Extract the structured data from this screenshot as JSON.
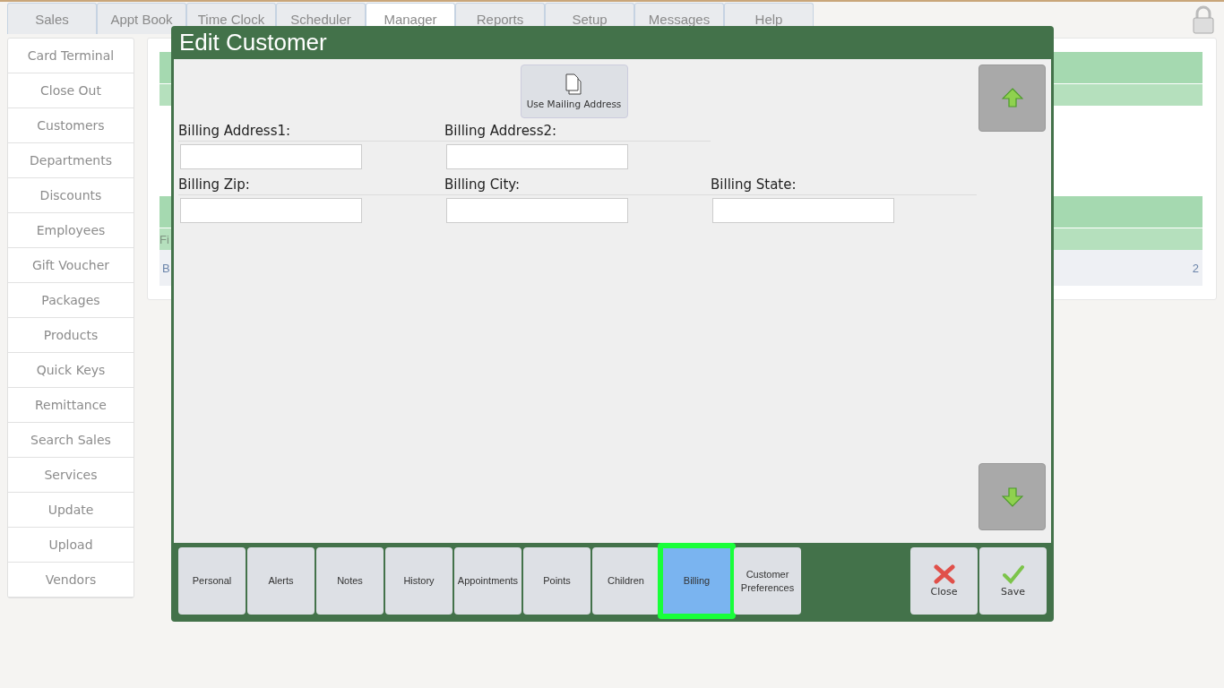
{
  "top_tabs": [
    {
      "label": "Sales",
      "selected": false
    },
    {
      "label": "Appt Book",
      "selected": false
    },
    {
      "label": "Time Clock",
      "selected": false
    },
    {
      "label": "Scheduler",
      "selected": false
    },
    {
      "label": "Manager",
      "selected": true
    },
    {
      "label": "Reports",
      "selected": false
    },
    {
      "label": "Setup",
      "selected": false
    },
    {
      "label": "Messages",
      "selected": false
    },
    {
      "label": "Help",
      "selected": false
    }
  ],
  "sidebar": {
    "items": [
      "Card Terminal",
      "Close Out",
      "Customers",
      "Departments",
      "Discounts",
      "Employees",
      "Gift Voucher",
      "Packages",
      "Products",
      "Quick Keys",
      "Remittance",
      "Search Sales",
      "Services",
      "Update",
      "Upload",
      "Vendors"
    ]
  },
  "background_table": {
    "header_cell": "Fi",
    "row_cells": [
      "B",
      "2"
    ]
  },
  "dialog": {
    "title": "Edit Customer",
    "use_mailing_button": "Use Mailing Address",
    "fields": [
      [
        {
          "label": "Billing Address1:"
        },
        {
          "label": "Billing Address2:"
        }
      ],
      [
        {
          "label": "Billing Zip:"
        },
        {
          "label": "Billing City:"
        },
        {
          "label": "Billing State:"
        }
      ]
    ],
    "tabs": [
      {
        "label": "Personal",
        "selected": false
      },
      {
        "label": "Alerts",
        "selected": false
      },
      {
        "label": "Notes",
        "selected": false
      },
      {
        "label": "History",
        "selected": false
      },
      {
        "label": "Appointments",
        "selected": false
      },
      {
        "label": "Points",
        "selected": false
      },
      {
        "label": "Children",
        "selected": false
      },
      {
        "label": "Billing",
        "selected": true
      },
      {
        "label": "Customer Preferences",
        "selected": false
      }
    ],
    "actions": [
      {
        "kind": "close",
        "label": "Close"
      },
      {
        "kind": "save",
        "label": "Save"
      }
    ]
  }
}
